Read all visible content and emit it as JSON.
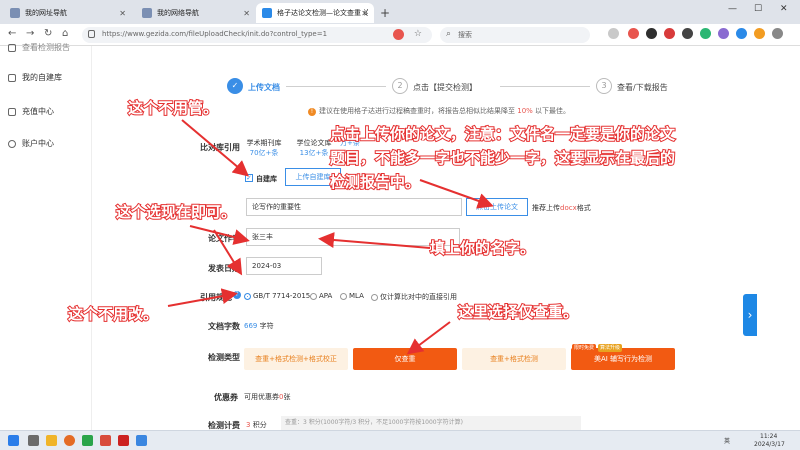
{
  "browser": {
    "tabs": [
      {
        "label": "我的网址导航",
        "active": false
      },
      {
        "label": "我的网络导航",
        "active": false
      },
      {
        "label": "格子达论文检测—论文查重 论文",
        "active": true
      }
    ],
    "new_tab": "+",
    "url": "https://www.gezida.com/fileUploadCheck/init.do?control_type=1",
    "search_placeholder": "搜索",
    "win_min": "—",
    "win_max": "☐",
    "win_close": "✕"
  },
  "sidebar": {
    "partial_item": "查看检测报告",
    "items": [
      {
        "label": "我的自建库"
      },
      {
        "label": "充值中心"
      },
      {
        "label": "账户中心"
      }
    ]
  },
  "steps": [
    {
      "num": "✓",
      "label": "上传文档"
    },
    {
      "num": "2",
      "label": "点击【提交检测】"
    },
    {
      "num": "3",
      "label": "查看/下载报告"
    }
  ],
  "notice": {
    "icon": "!",
    "prefix": "建议在使用格子达进行过程稿查重时，将报告总相似比结果降至",
    "pct": "10%",
    "suffix": "以下最佳。"
  },
  "form": {
    "compare_label": "比对库引用",
    "databases": [
      {
        "name": "学术期刊库",
        "count": "70亿+条"
      },
      {
        "name": "学位论文库",
        "count": "13亿+条"
      },
      {
        "name": "",
        "count": "万+条"
      }
    ],
    "self_built_check": "✓",
    "self_built_label": "自建库",
    "upload_self_built": "上传自建库",
    "file_name_value": "论写作的重要性",
    "upload_paper_button": "点击上传论文",
    "upload_tip_prefix": "推荐上传",
    "upload_tip_format": "docx",
    "upload_tip_suffix": "格式",
    "author_label": "论文作者",
    "author_value": "张三丰",
    "date_label": "发表日期",
    "date_value": "2024-03",
    "citation_label": "引用规范",
    "citation_help": "?",
    "citation_options": [
      {
        "label": "GB/T 7714-2015",
        "selected": true
      },
      {
        "label": "APA",
        "selected": false
      },
      {
        "label": "MLA",
        "selected": false
      },
      {
        "label": "仅计算比对中的直接引用",
        "selected": false
      }
    ],
    "word_count_label": "文档字数",
    "word_count_value": "669",
    "word_count_unit": "字符",
    "check_type_label": "检测类型",
    "check_types": [
      {
        "label": "查重+格式检测+格式校正",
        "style": "light"
      },
      {
        "label": "仅查重",
        "style": "solid"
      },
      {
        "label": "查重+格式检测",
        "style": "light"
      },
      {
        "label": "美AI 辅写行为检测",
        "style": "solid"
      }
    ],
    "badge_1": "限时免费",
    "badge_2": "算法升级",
    "coupon_label": "优惠券",
    "coupon_prefix": "可用优惠券",
    "coupon_count": "0",
    "coupon_suffix": "张",
    "fee_label": "检测计费",
    "fee_value": "3",
    "fee_unit": "积分",
    "fee_detail": "查重：3 积分(1000字符/3 积分，不足1000字符按1000字符计算)"
  },
  "right_tab_arrow": "›",
  "annotations": {
    "a1": "这个不用管。",
    "a2_line1": "点击上传你的论文，注意：文件名一定要是你的论文",
    "a2_line2": "题目，不能多一字也不能少一字，这要显示在最后的",
    "a2_line3": "检测报告中。",
    "a3": "这个选现在即可。",
    "a4": "填上你的名字。",
    "a5": "这个不用改。",
    "a6": "这里选择仅查重。"
  },
  "taskbar": {
    "lang": "英",
    "time": "11:24",
    "date": "2024/3/17"
  },
  "colors": {
    "accent_blue": "#3a8ee6",
    "orange": "#f25a12",
    "annotation_red": "#e53030"
  }
}
